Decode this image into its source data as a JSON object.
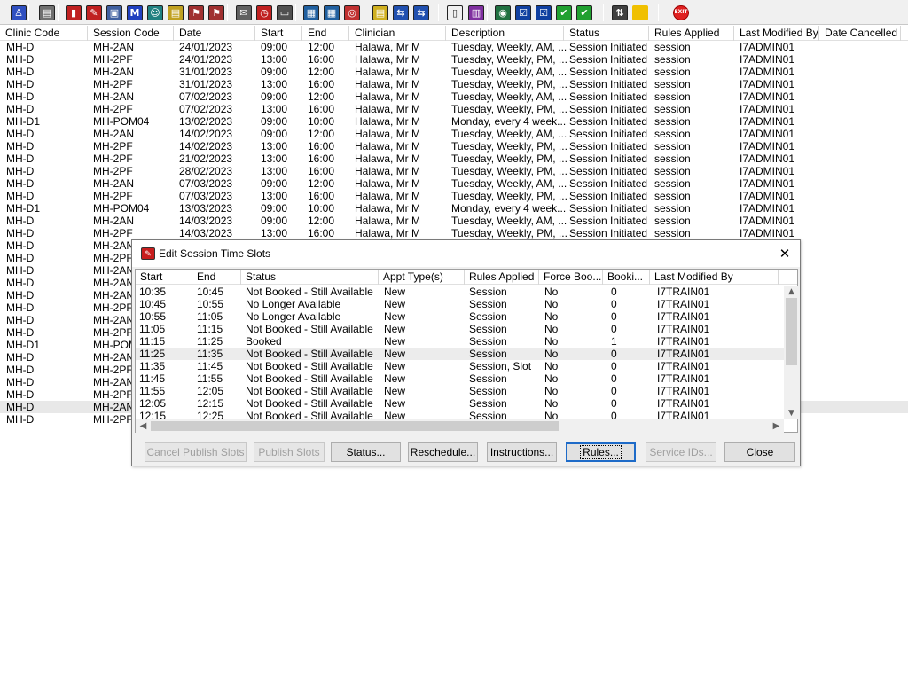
{
  "toolbar": {
    "icons": [
      "person-icon",
      "print-icon",
      "book-icon",
      "edit-icon",
      "screen-icon",
      "letter-m-icon",
      "user-icon",
      "notebook-icon",
      "flag-icon",
      "flag-icon",
      "arrow-document-icon",
      "clock-icon",
      "window-icon",
      "id-card-icon",
      "id-card-icon",
      "disc-icon",
      "notepad-icon",
      "transfer-icon",
      "user-transfer-icon",
      "blank-document-icon",
      "bar-chart-icon",
      "globe-icon",
      "list-check-icon",
      "list-check-icon",
      "check-green-icon",
      "check-green-icon",
      "swap-icon",
      "warning-icon",
      "exit-icon"
    ],
    "exit_label": "EXIT"
  },
  "main_grid": {
    "columns": [
      "Clinic Code",
      "Session Code",
      "Date",
      "Start",
      "End",
      "Clinician",
      "Description",
      "Status",
      "Rules Applied",
      "Last Modified By",
      "Date Cancelled"
    ],
    "rows": [
      [
        "MH-D",
        "MH-2AN",
        "24/01/2023",
        "09:00",
        "12:00",
        "Halawa, Mr M",
        "Tuesday, Weekly, AM, ...",
        "Session Initiated",
        "session",
        "I7ADMIN01"
      ],
      [
        "MH-D",
        "MH-2PF",
        "24/01/2023",
        "13:00",
        "16:00",
        "Halawa, Mr M",
        "Tuesday, Weekly, PM, ...",
        "Session Initiated",
        "session",
        "I7ADMIN01"
      ],
      [
        "MH-D",
        "MH-2AN",
        "31/01/2023",
        "09:00",
        "12:00",
        "Halawa, Mr M",
        "Tuesday, Weekly, AM, ...",
        "Session Initiated",
        "session",
        "I7ADMIN01"
      ],
      [
        "MH-D",
        "MH-2PF",
        "31/01/2023",
        "13:00",
        "16:00",
        "Halawa, Mr M",
        "Tuesday, Weekly, PM, ...",
        "Session Initiated",
        "session",
        "I7ADMIN01"
      ],
      [
        "MH-D",
        "MH-2AN",
        "07/02/2023",
        "09:00",
        "12:00",
        "Halawa, Mr M",
        "Tuesday, Weekly, AM, ...",
        "Session Initiated",
        "session",
        "I7ADMIN01"
      ],
      [
        "MH-D",
        "MH-2PF",
        "07/02/2023",
        "13:00",
        "16:00",
        "Halawa, Mr M",
        "Tuesday, Weekly, PM, ...",
        "Session Initiated",
        "session",
        "I7ADMIN01"
      ],
      [
        "MH-D1",
        "MH-POM04",
        "13/02/2023",
        "09:00",
        "10:00",
        "Halawa, Mr M",
        "Monday, every 4 week...",
        "Session Initiated",
        "session",
        "I7ADMIN01"
      ],
      [
        "MH-D",
        "MH-2AN",
        "14/02/2023",
        "09:00",
        "12:00",
        "Halawa, Mr M",
        "Tuesday, Weekly, AM, ...",
        "Session Initiated",
        "session",
        "I7ADMIN01"
      ],
      [
        "MH-D",
        "MH-2PF",
        "14/02/2023",
        "13:00",
        "16:00",
        "Halawa, Mr M",
        "Tuesday, Weekly, PM, ...",
        "Session Initiated",
        "session",
        "I7ADMIN01"
      ],
      [
        "MH-D",
        "MH-2PF",
        "21/02/2023",
        "13:00",
        "16:00",
        "Halawa, Mr M",
        "Tuesday, Weekly, PM, ...",
        "Session Initiated",
        "session",
        "I7ADMIN01"
      ],
      [
        "MH-D",
        "MH-2PF",
        "28/02/2023",
        "13:00",
        "16:00",
        "Halawa, Mr M",
        "Tuesday, Weekly, PM, ...",
        "Session Initiated",
        "session",
        "I7ADMIN01"
      ],
      [
        "MH-D",
        "MH-2AN",
        "07/03/2023",
        "09:00",
        "12:00",
        "Halawa, Mr M",
        "Tuesday, Weekly, AM, ...",
        "Session Initiated",
        "session",
        "I7ADMIN01"
      ],
      [
        "MH-D",
        "MH-2PF",
        "07/03/2023",
        "13:00",
        "16:00",
        "Halawa, Mr M",
        "Tuesday, Weekly, PM, ...",
        "Session Initiated",
        "session",
        "I7ADMIN01"
      ],
      [
        "MH-D1",
        "MH-POM04",
        "13/03/2023",
        "09:00",
        "10:00",
        "Halawa, Mr M",
        "Monday, every 4 week...",
        "Session Initiated",
        "session",
        "I7ADMIN01"
      ],
      [
        "MH-D",
        "MH-2AN",
        "14/03/2023",
        "09:00",
        "12:00",
        "Halawa, Mr M",
        "Tuesday, Weekly, AM, ...",
        "Session Initiated",
        "session",
        "I7ADMIN01"
      ],
      [
        "MH-D",
        "MH-2PF",
        "14/03/2023",
        "13:00",
        "16:00",
        "Halawa, Mr M",
        "Tuesday, Weekly, PM, ...",
        "Session Initiated",
        "session",
        "I7ADMIN01"
      ],
      [
        "MH-D",
        "MH-2AN"
      ],
      [
        "MH-D",
        "MH-2PF"
      ],
      [
        "MH-D",
        "MH-2AN"
      ],
      [
        "MH-D",
        "MH-2AN"
      ],
      [
        "MH-D",
        "MH-2AN"
      ],
      [
        "MH-D",
        "MH-2PF"
      ],
      [
        "MH-D",
        "MH-2AN"
      ],
      [
        "MH-D",
        "MH-2PF"
      ],
      [
        "MH-D1",
        "MH-POM"
      ],
      [
        "MH-D",
        "MH-2AN"
      ],
      [
        "MH-D",
        "MH-2PF"
      ],
      [
        "MH-D",
        "MH-2AN"
      ],
      [
        "MH-D",
        "MH-2PF"
      ],
      [
        "MH-D",
        "MH-2AN"
      ],
      [
        "MH-D",
        "MH-2PF"
      ]
    ],
    "selected_row": 29
  },
  "dialog": {
    "title": "Edit Session Time Slots",
    "columns": [
      "Start",
      "End",
      "Status",
      "Appt Type(s)",
      "Rules Applied",
      "Force Boo...",
      "Booki...",
      "Last Modified By"
    ],
    "rows": [
      [
        "10:35",
        "10:45",
        "Not Booked - Still Available",
        "New",
        "Session",
        "No",
        "0",
        "I7TRAIN01"
      ],
      [
        "10:45",
        "10:55",
        "No Longer Available",
        "New",
        "Session",
        "No",
        "0",
        "I7TRAIN01"
      ],
      [
        "10:55",
        "11:05",
        "No Longer Available",
        "New",
        "Session",
        "No",
        "0",
        "I7TRAIN01"
      ],
      [
        "11:05",
        "11:15",
        "Not Booked - Still Available",
        "New",
        "Session",
        "No",
        "0",
        "I7TRAIN01"
      ],
      [
        "11:15",
        "11:25",
        "Booked",
        "New",
        "Session",
        "No",
        "1",
        "I7TRAIN01"
      ],
      [
        "11:25",
        "11:35",
        "Not Booked - Still Available",
        "New",
        "Session",
        "No",
        "0",
        "I7TRAIN01"
      ],
      [
        "11:35",
        "11:45",
        "Not Booked - Still Available",
        "New",
        "Session, Slot",
        "No",
        "0",
        "I7TRAIN01"
      ],
      [
        "11:45",
        "11:55",
        "Not Booked - Still Available",
        "New",
        "Session",
        "No",
        "0",
        "I7TRAIN01"
      ],
      [
        "11:55",
        "12:05",
        "Not Booked - Still Available",
        "New",
        "Session",
        "No",
        "0",
        "I7TRAIN01"
      ],
      [
        "12:05",
        "12:15",
        "Not Booked - Still Available",
        "New",
        "Session",
        "No",
        "0",
        "I7TRAIN01"
      ],
      [
        "12:15",
        "12:25",
        "Not Booked - Still Available",
        "New",
        "Session",
        "No",
        "0",
        "I7TRAIN01"
      ]
    ],
    "selected_row": 5,
    "buttons": [
      {
        "name": "cancel-publish-slots-button",
        "label": "Cancel Publish Slots",
        "enabled": false
      },
      {
        "name": "publish-slots-button",
        "label": "Publish Slots",
        "enabled": false
      },
      {
        "name": "status-button",
        "label": "Status...",
        "enabled": true
      },
      {
        "name": "reschedule-button",
        "label": "Reschedule...",
        "enabled": true
      },
      {
        "name": "instructions-button",
        "label": "Instructions...",
        "enabled": true
      },
      {
        "name": "rules-button",
        "label": "Rules...",
        "enabled": true,
        "focused": true
      },
      {
        "name": "service-ids-button",
        "label": "Service IDs...",
        "enabled": false
      },
      {
        "name": "close-button",
        "label": "Close",
        "enabled": true
      }
    ]
  },
  "colors": {
    "selection_gray": "#e8e8e8",
    "focus_blue": "#1e6bc8",
    "exit_red": "#e02020",
    "disabled_text": "#a0a0a0"
  }
}
